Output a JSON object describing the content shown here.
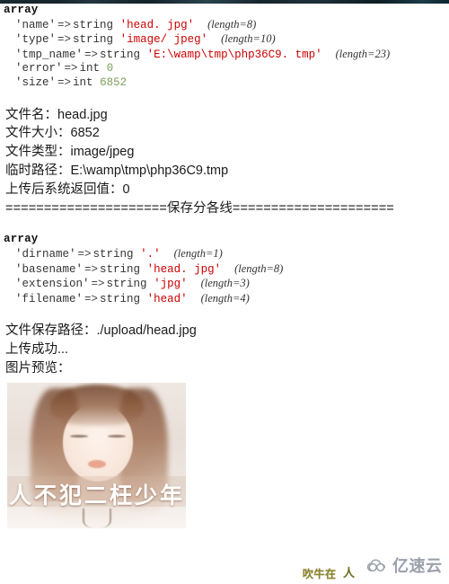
{
  "page": {
    "background": "#ffffff",
    "title": "PHP file upload var_dump output"
  },
  "colors": {
    "string_value": "#cc0000",
    "int_value": "#7ba05b",
    "text": "#1a1a1a",
    "watermark": "#9aa0ab",
    "badge": "#8d8424"
  },
  "dump_files": {
    "keyword": "array",
    "rows": [
      {
        "key": "'name'",
        "arrow": "=>",
        "type": "string",
        "value": "'head. jpg'",
        "value_kind": "string",
        "length": "(length=8)"
      },
      {
        "key": "'type'",
        "arrow": "=>",
        "type": "string",
        "value": "'image/ jpeg'",
        "value_kind": "string",
        "length": "(length=10)"
      },
      {
        "key": "'tmp_name'",
        "arrow": "=>",
        "type": "string",
        "value": "'E:\\wamp\\tmp\\php36C9. tmp'",
        "value_kind": "string",
        "length": "(length=23)"
      },
      {
        "key": "'error'",
        "arrow": "=>",
        "type": "int",
        "value": "0",
        "value_kind": "int",
        "length": ""
      },
      {
        "key": "'size'",
        "arrow": "=>",
        "type": "int",
        "value": "6852",
        "value_kind": "int",
        "length": ""
      }
    ]
  },
  "info_lines": {
    "file_name": "文件名：head.jpg",
    "file_size": "文件大小：6852",
    "file_type": "文件类型：image/jpeg",
    "tmp_path": "临时路径：E:\\wamp\\tmp\\php36C9.tmp",
    "upload_return": "上传后系统返回值：0"
  },
  "separator": "=====================保存分各线=====================",
  "dump_pathinfo": {
    "keyword": "array",
    "rows": [
      {
        "key": "'dirname'",
        "arrow": "=>",
        "type": "string",
        "value": "'.'",
        "value_kind": "string",
        "length": "(length=1)"
      },
      {
        "key": "'basename'",
        "arrow": "=>",
        "type": "string",
        "value": "'head. jpg'",
        "value_kind": "string",
        "length": "(length=8)"
      },
      {
        "key": "'extension'",
        "arrow": "=>",
        "type": "string",
        "value": "'jpg'",
        "value_kind": "string",
        "length": "(length=3)"
      },
      {
        "key": "'filename'",
        "arrow": "=>",
        "type": "string",
        "value": "'head'",
        "value_kind": "string",
        "length": "(length=4)"
      }
    ]
  },
  "result_lines": {
    "save_path": "文件保存路径：./upload/head.jpg",
    "upload_ok": "上传成功...",
    "preview_label": "图片预览："
  },
  "preview": {
    "caption": "人不犯二枉少年",
    "alt": "uploaded portrait photo head.jpg"
  },
  "watermarks": {
    "badge_text": "吹牛在",
    "person_glyph": "人",
    "cloud_text": "亿速云",
    "cloud_icon": "cloud-icon"
  }
}
